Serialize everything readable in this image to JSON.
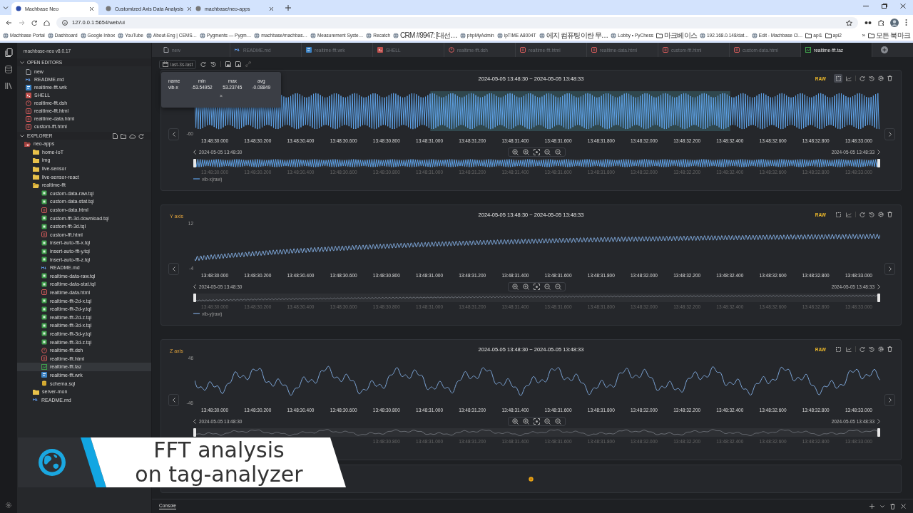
{
  "browser": {
    "tabs": [
      {
        "title": "Machbase Neo",
        "selected": true
      },
      {
        "title": "Customized Axis Data Analysis",
        "selected": false
      },
      {
        "title": "machbase/neo-apps",
        "selected": false
      }
    ],
    "address": "127.0.0.1:5654/web/ui",
    "bookmarks": [
      {
        "label": "Machbase Portal",
        "kind": "page"
      },
      {
        "label": "Dashboard",
        "kind": "page"
      },
      {
        "label": "Google Inbox",
        "kind": "page"
      },
      {
        "label": "YouTube",
        "kind": "page"
      },
      {
        "label": "About-Eng | CEMS…",
        "kind": "page"
      },
      {
        "label": "Pygments — Pygm…",
        "kind": "page"
      },
      {
        "label": "machbase/machbas…",
        "kind": "page"
      },
      {
        "label": "Measurement Syste…",
        "kind": "page"
      },
      {
        "label": "Recatch",
        "kind": "page"
      },
      {
        "label": "CRM #9947: [대선…",
        "kind": "page"
      },
      {
        "label": "phpMyAdmin",
        "kind": "page"
      },
      {
        "label": "ipTIME A8004T",
        "kind": "page"
      },
      {
        "label": "에지 컴퓨팅이란 무…",
        "kind": "page"
      },
      {
        "label": "Lobby • PyChess",
        "kind": "page"
      },
      {
        "label": "마크베이스",
        "kind": "folder"
      },
      {
        "label": "192.168.0.148/dat…",
        "kind": "page"
      },
      {
        "label": "Edit - Machbase Cl…",
        "kind": "page"
      },
      {
        "label": "api1",
        "kind": "folder"
      },
      {
        "label": "api2",
        "kind": "folder"
      }
    ],
    "bookmarks_overflow": "»",
    "all_bookmarks": "모든 북마크"
  },
  "sidebar": {
    "version": "machbase-neo v8.0.17",
    "open_editors_title": "OPEN EDITORS",
    "open_editors": [
      {
        "name": "new",
        "kind": "new"
      },
      {
        "name": "README.md",
        "kind": "md"
      },
      {
        "name": "realtime-fft.wrk",
        "kind": "wrk"
      },
      {
        "name": "SHELL",
        "kind": "shell"
      },
      {
        "name": "realtime-fft.dsh",
        "kind": "dsh"
      },
      {
        "name": "realtime-fft.html",
        "kind": "html"
      },
      {
        "name": "realtime-data.html",
        "kind": "html"
      },
      {
        "name": "custom-fft.html",
        "kind": "html"
      }
    ],
    "explorer_title": "EXPLORER",
    "explorer": [
      {
        "name": "neo-apps",
        "kind": "project",
        "expanded": true,
        "selected": false,
        "children": [
          {
            "name": "home-IoT",
            "kind": "folder",
            "expanded": false,
            "selected": false
          },
          {
            "name": "img",
            "kind": "folder",
            "expanded": false,
            "selected": false
          },
          {
            "name": "live-sensor",
            "kind": "folder",
            "expanded": false,
            "selected": false
          },
          {
            "name": "live-sensor-react",
            "kind": "folder",
            "expanded": false,
            "selected": false
          },
          {
            "name": "realtime-fft",
            "kind": "folder",
            "expanded": true,
            "selected": false,
            "children": [
              {
                "name": "custom-data-raw.tql",
                "kind": "tql",
                "selected": false
              },
              {
                "name": "custom-data-stat.tql",
                "kind": "tql",
                "selected": false
              },
              {
                "name": "custom-data.html",
                "kind": "html",
                "selected": false
              },
              {
                "name": "custom-fft-3d-download.tql",
                "kind": "tql",
                "selected": false
              },
              {
                "name": "custom-fft-3d.tql",
                "kind": "tql",
                "selected": false
              },
              {
                "name": "custom-fft.html",
                "kind": "html",
                "selected": false
              },
              {
                "name": "insert-auto-fft-x.tql",
                "kind": "tql",
                "selected": false
              },
              {
                "name": "insert-auto-fft-y.tql",
                "kind": "tql",
                "selected": false
              },
              {
                "name": "insert-auto-fft-z.tql",
                "kind": "tql",
                "selected": false
              },
              {
                "name": "README.md",
                "kind": "md",
                "selected": false
              },
              {
                "name": "realtime-data-raw.tql",
                "kind": "tql",
                "selected": false
              },
              {
                "name": "realtime-data-stat.tql",
                "kind": "tql",
                "selected": false
              },
              {
                "name": "realtime-data.html",
                "kind": "html",
                "selected": false
              },
              {
                "name": "realtime-fft-2d-x.tql",
                "kind": "tql",
                "selected": false
              },
              {
                "name": "realtime-fft-2d-y.tql",
                "kind": "tql",
                "selected": false
              },
              {
                "name": "realtime-fft-2d-z.tql",
                "kind": "tql",
                "selected": false
              },
              {
                "name": "realtime-fft-3d-x.tql",
                "kind": "tql",
                "selected": false
              },
              {
                "name": "realtime-fft-3d-y.tql",
                "kind": "tql",
                "selected": false
              },
              {
                "name": "realtime-fft-3d-z.tql",
                "kind": "tql",
                "selected": false
              },
              {
                "name": "realtime-fft.dsh",
                "kind": "dsh",
                "selected": false
              },
              {
                "name": "realtime-fft.html",
                "kind": "html",
                "selected": false
              },
              {
                "name": "realtime-fft.taz",
                "kind": "taz",
                "selected": true
              },
              {
                "name": "realtime-fft.wrk",
                "kind": "wrk",
                "selected": false
              },
              {
                "name": "schema.sql",
                "kind": "sql",
                "selected": false
              }
            ]
          },
          {
            "name": "server-mon",
            "kind": "folder",
            "expanded": false,
            "selected": false
          },
          {
            "name": "README.md",
            "kind": "md",
            "selected": false
          }
        ]
      }
    ]
  },
  "editor_tabs": [
    {
      "label": "new",
      "kind": "new",
      "selected": false
    },
    {
      "label": "README.md",
      "kind": "md",
      "selected": false
    },
    {
      "label": "realtime-fft.wrk",
      "kind": "wrk",
      "selected": false
    },
    {
      "label": "SHELL",
      "kind": "shell",
      "selected": false
    },
    {
      "label": "realtime-fft.dsh",
      "kind": "dsh",
      "selected": false
    },
    {
      "label": "realtime-fft.html",
      "kind": "html",
      "selected": false
    },
    {
      "label": "realtime-data.html",
      "kind": "html",
      "selected": false
    },
    {
      "label": "custom-fft.html",
      "kind": "html",
      "selected": false
    },
    {
      "label": "custom-data.html",
      "kind": "html",
      "selected": false
    },
    {
      "label": "realtime-fft.taz",
      "kind": "taz",
      "selected": true
    }
  ],
  "toolbar": {
    "time_range": "last-3s-last"
  },
  "stats_popup": {
    "columns": [
      "name",
      "min",
      "max",
      "avg"
    ],
    "rows": [
      [
        "vib-x",
        "-53.54952",
        "53.23745",
        "-0.08849"
      ]
    ],
    "close": "×"
  },
  "panels": [
    {
      "kind": "burst",
      "range": "2024-05-05 13:48:30 ~ 2024-05-05 13:48:33",
      "badge": "RAW",
      "select_mode": true,
      "y_min": "-60",
      "x_ticks": [
        "13:48:30.000",
        "13:48:30.200",
        "13:48:30.400",
        "13:48:30.600",
        "13:48:30.800",
        "13:48:31.000",
        "13:48:31.200",
        "13:48:31.400",
        "13:48:31.600",
        "13:48:31.800",
        "13:48:32.000",
        "13:48:32.200",
        "13:48:32.400",
        "13:48:32.600",
        "13:48:32.800",
        "13:48:33.000"
      ],
      "nav_start": "2024-05-05 13:48:30",
      "nav_end": "2024-05-05 13:48:33",
      "nav_ticks": [
        "13:48:30.000",
        "13:48:30.200",
        "13:48:30.400",
        "13:48:30.600",
        "13:48:30.800",
        "13:48:31.000",
        "13:48:31.200",
        "13:48:31.400",
        "13:48:31.600",
        "13:48:31.800",
        "13:48:32.000",
        "13:48:32.200",
        "13:48:32.400",
        "13:48:32.600",
        "13:48:32.800",
        "13:48:33.000"
      ],
      "legend": "vib-x(raw)"
    },
    {
      "kind": "trend",
      "title": "Y axis",
      "range": "2024-05-05 13:48:30 ~ 2024-05-05 13:48:33",
      "badge": "RAW",
      "select_mode": false,
      "y_max": "12",
      "y_min": "-4",
      "x_ticks": [
        "13:48:30.000",
        "13:48:30.200",
        "13:48:30.400",
        "13:48:30.600",
        "13:48:30.800",
        "13:48:31.000",
        "13:48:31.200",
        "13:48:31.400",
        "13:48:31.600",
        "13:48:31.800",
        "13:48:32.000",
        "13:48:32.200",
        "13:48:32.400",
        "13:48:32.600",
        "13:48:32.800",
        "13:48:33.000"
      ],
      "nav_start": "2024-05-05 13:48:30",
      "nav_end": "2024-05-05 13:48:33",
      "nav_ticks": [
        "13:48:30.000",
        "13:48:30.200",
        "13:48:30.400",
        "13:48:30.600",
        "13:48:30.800",
        "13:48:31.000",
        "13:48:31.200",
        "13:48:31.400",
        "13:48:31.600",
        "13:48:31.800",
        "13:48:32.000",
        "13:48:32.200",
        "13:48:32.400",
        "13:48:32.600",
        "13:48:32.800",
        "13:48:33.000"
      ],
      "legend": "vib-y(raw)"
    },
    {
      "kind": "wave",
      "title": "Z axis",
      "range": "2024-05-05 13:48:30 ~ 2024-05-05 13:48:33",
      "badge": "RAW",
      "select_mode": false,
      "y_max": "46",
      "y_min": "-46",
      "x_ticks": [
        "13:48:30.000",
        "13:48:30.200",
        "13:48:30.400",
        "13:48:30.600",
        "13:48:30.800",
        "13:48:31.000",
        "13:48:31.200",
        "13:48:31.400",
        "13:48:31.600",
        "13:48:31.800",
        "13:48:32.000",
        "13:48:32.200",
        "13:48:32.400",
        "13:48:32.600",
        "13:48:32.800",
        "13:48:33.000"
      ],
      "nav_start": "2024-05-05 13:48:30",
      "nav_end": "2024-05-05 13:48:33",
      "nav_ticks": [
        "13:48:30.800",
        "13:48:31.000",
        "13:48:31.200",
        "13:48:31.400",
        "13:48:31.600",
        "13:48:31.800",
        "13:48:32.000",
        "13:48:32.200",
        "13:48:32.400",
        "13:48:32.600",
        "13:48:32.800",
        "13:48:33.000"
      ]
    }
  ],
  "console": {
    "label": "Console"
  },
  "banner": {
    "text": "FFT analysis\non tag-analyzer"
  }
}
